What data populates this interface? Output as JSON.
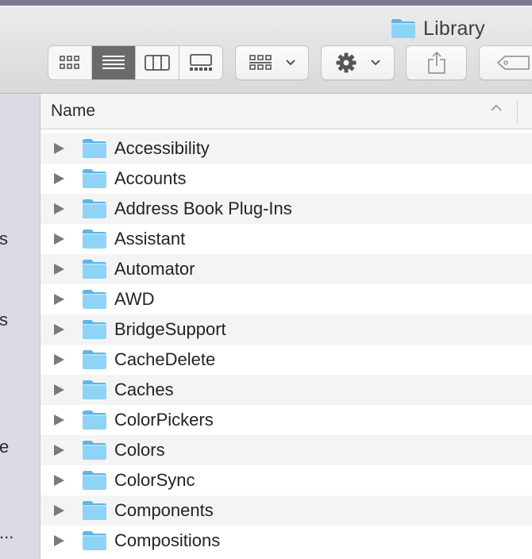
{
  "window": {
    "title": "Library"
  },
  "toolbar": {
    "view_modes": [
      {
        "name": "icon-view",
        "icon": "grid-icon",
        "active": false
      },
      {
        "name": "list-view",
        "icon": "list-icon",
        "active": true
      },
      {
        "name": "column-view",
        "icon": "columns-icon",
        "active": false
      },
      {
        "name": "gallery-view",
        "icon": "gallery-icon",
        "active": false
      }
    ],
    "group_icon": "group-grid-icon",
    "action_icon": "gear-icon",
    "share_icon": "share-icon",
    "tag_icon": "tag-icon"
  },
  "sidebar": {
    "fragments": [
      "s",
      "s",
      "e",
      "..."
    ]
  },
  "list": {
    "column_name": "Name",
    "sort": "ascending",
    "items": [
      {
        "label": "Accessibility"
      },
      {
        "label": "Accounts"
      },
      {
        "label": "Address Book Plug-Ins"
      },
      {
        "label": "Assistant"
      },
      {
        "label": "Automator"
      },
      {
        "label": "AWD"
      },
      {
        "label": "BridgeSupport"
      },
      {
        "label": "CacheDelete"
      },
      {
        "label": "Caches"
      },
      {
        "label": "ColorPickers"
      },
      {
        "label": "Colors"
      },
      {
        "label": "ColorSync"
      },
      {
        "label": "Components"
      },
      {
        "label": "Compositions"
      }
    ]
  },
  "colors": {
    "folder": "#7cc8f2",
    "active_segment": "#6b6b6b",
    "sidebar_bg": "#dadbe3",
    "row_alt": "#f4f4f5"
  }
}
